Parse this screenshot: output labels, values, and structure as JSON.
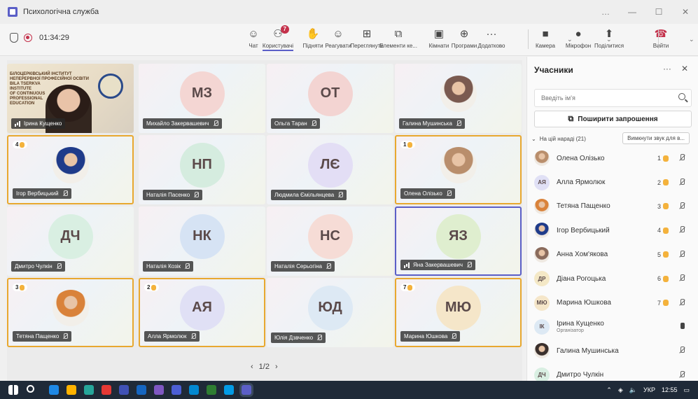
{
  "window": {
    "title": "Психологічна служба",
    "controls": [
      "…",
      "—",
      "☐",
      "✕"
    ]
  },
  "toolbar": {
    "timer": "01:34:29",
    "items": [
      {
        "label": "Чат",
        "icon": "chat-icon"
      },
      {
        "label": "Користувачі",
        "icon": "people-icon",
        "badge": "7"
      },
      {
        "label": "Підняти",
        "icon": "raise-hand-icon"
      },
      {
        "label": "Реагувати",
        "icon": "emoji-icon"
      },
      {
        "label": "Переглянути",
        "icon": "view-icon"
      },
      {
        "label": "Елементи ке...",
        "icon": "apps-icon"
      },
      {
        "label": "Кімнати",
        "icon": "rooms-icon"
      },
      {
        "label": "Програми",
        "icon": "add-app-icon"
      },
      {
        "label": "Додатково",
        "icon": "more-icon"
      },
      {
        "label": "Камера",
        "icon": "camera-icon"
      },
      {
        "label": "Мікрофон",
        "icon": "mic-icon"
      },
      {
        "label": "Поділитися",
        "icon": "share-icon"
      },
      {
        "label": "Вийти",
        "icon": "hangup-icon"
      }
    ]
  },
  "grid": {
    "tiles": [
      {
        "name": "Ірина Кущенко",
        "type": "video",
        "speaking": true,
        "banner": [
          "БІЛОЦЕРКІВСЬКИЙ ІНСТИТУТ",
          "НЕПЕРЕРВНОЇ ПРОФЕСІЙНОЇ ОСВІТИ",
          "BILA TSERKVA",
          "INSTITUTE",
          "OF CONTINUOUS",
          "PROFESSIONAL",
          "EDUCATION"
        ]
      },
      {
        "name": "Михайло Закервашевич",
        "initials": "МЗ",
        "color": "#f4d6d3"
      },
      {
        "name": "Ольга Таран",
        "initials": "ОТ",
        "color": "#f3d4d2"
      },
      {
        "name": "Галина Мушинська",
        "type": "photo",
        "photo": "#7a5a50"
      },
      {
        "name": "Ігор Вербицький",
        "type": "photo",
        "photo": "#1f3b8a",
        "hand": "4",
        "highlight": true
      },
      {
        "name": "Наталія Пасенко",
        "initials": "НП",
        "color": "#d5ecdf"
      },
      {
        "name": "Людмила Ємільянцева",
        "initials": "ЛЄ",
        "color": "#e3def5"
      },
      {
        "name": "Олена Олізько",
        "type": "photo",
        "photo": "#b98e6c",
        "hand": "1",
        "highlight": true
      },
      {
        "name": "Дмитро Чулкін",
        "initials": "ДЧ",
        "color": "#d9efe2"
      },
      {
        "name": "Наталія Козік",
        "initials": "НК",
        "color": "#d6e3f4"
      },
      {
        "name": "Наталія Серьогіна",
        "initials": "НС",
        "color": "#f6dcd6"
      },
      {
        "name": "Яна Закервашевич",
        "initials": "ЯЗ",
        "color": "#dfeecf",
        "blue": true,
        "speaking": true
      },
      {
        "name": "Тетяна Пащенко",
        "type": "photo",
        "photo": "#d9823a",
        "hand": "3",
        "highlight": true
      },
      {
        "name": "Алла Ярмолюк",
        "initials": "АЯ",
        "color": "#e0e0f5",
        "hand": "2",
        "highlight": true
      },
      {
        "name": "Юлія Дзвченко",
        "initials": "ЮД",
        "color": "#dde9f4"
      },
      {
        "name": "Марина Юшкова",
        "initials": "МЮ",
        "color": "#f5e6c9",
        "hand": "7",
        "highlight": true
      }
    ],
    "pager": {
      "text": "1/2",
      "prev": "‹",
      "next": "›"
    }
  },
  "panel": {
    "title": "Учасники",
    "search_placeholder": "Введіть ім'я",
    "share_label": "Поширити запрошення",
    "section": "На цій нараді (21)",
    "mute_all": "Вимкнути звук для в...",
    "people": [
      {
        "name": "Олена Олізько",
        "hand": "1",
        "photo": "#b98e6c"
      },
      {
        "name": "Алла Ярмолюк",
        "hand": "2",
        "initials": "АЯ",
        "color": "#e0e0f5"
      },
      {
        "name": "Тетяна Пащенко",
        "hand": "3",
        "photo": "#d9823a"
      },
      {
        "name": "Ігор Вербицький",
        "hand": "4",
        "photo": "#1f3b8a"
      },
      {
        "name": "Анна Хом'якова",
        "hand": "5",
        "photo": "#8a6b5c"
      },
      {
        "name": "Діана Рогоцька",
        "hand": "6",
        "initials": "ДР",
        "color": "#f4e8c6"
      },
      {
        "name": "Марина Юшкова",
        "hand": "7",
        "initials": "МЮ",
        "color": "#f5e6c9"
      },
      {
        "name": "Ірина Кущенко",
        "role": "Організатор",
        "initials": "ІК",
        "color": "#dde9f4",
        "mic": "on"
      },
      {
        "name": "Галина Мушинська",
        "photo": "#3a2f2c"
      },
      {
        "name": "Дмитро Чулкін",
        "initials": "ДЧ",
        "color": "#d9efe2"
      }
    ]
  },
  "taskbar": {
    "apps": [
      "#1e88e5",
      "#ffb300",
      "#26a69a",
      "#e53935",
      "#3f51b5",
      "#1565c0",
      "#7e57c2",
      "#4c5fd5",
      "#0288d1",
      "#2e7d32",
      "#039be5",
      "#5b5fc7"
    ],
    "lang": "УКР",
    "time": "12:55"
  }
}
